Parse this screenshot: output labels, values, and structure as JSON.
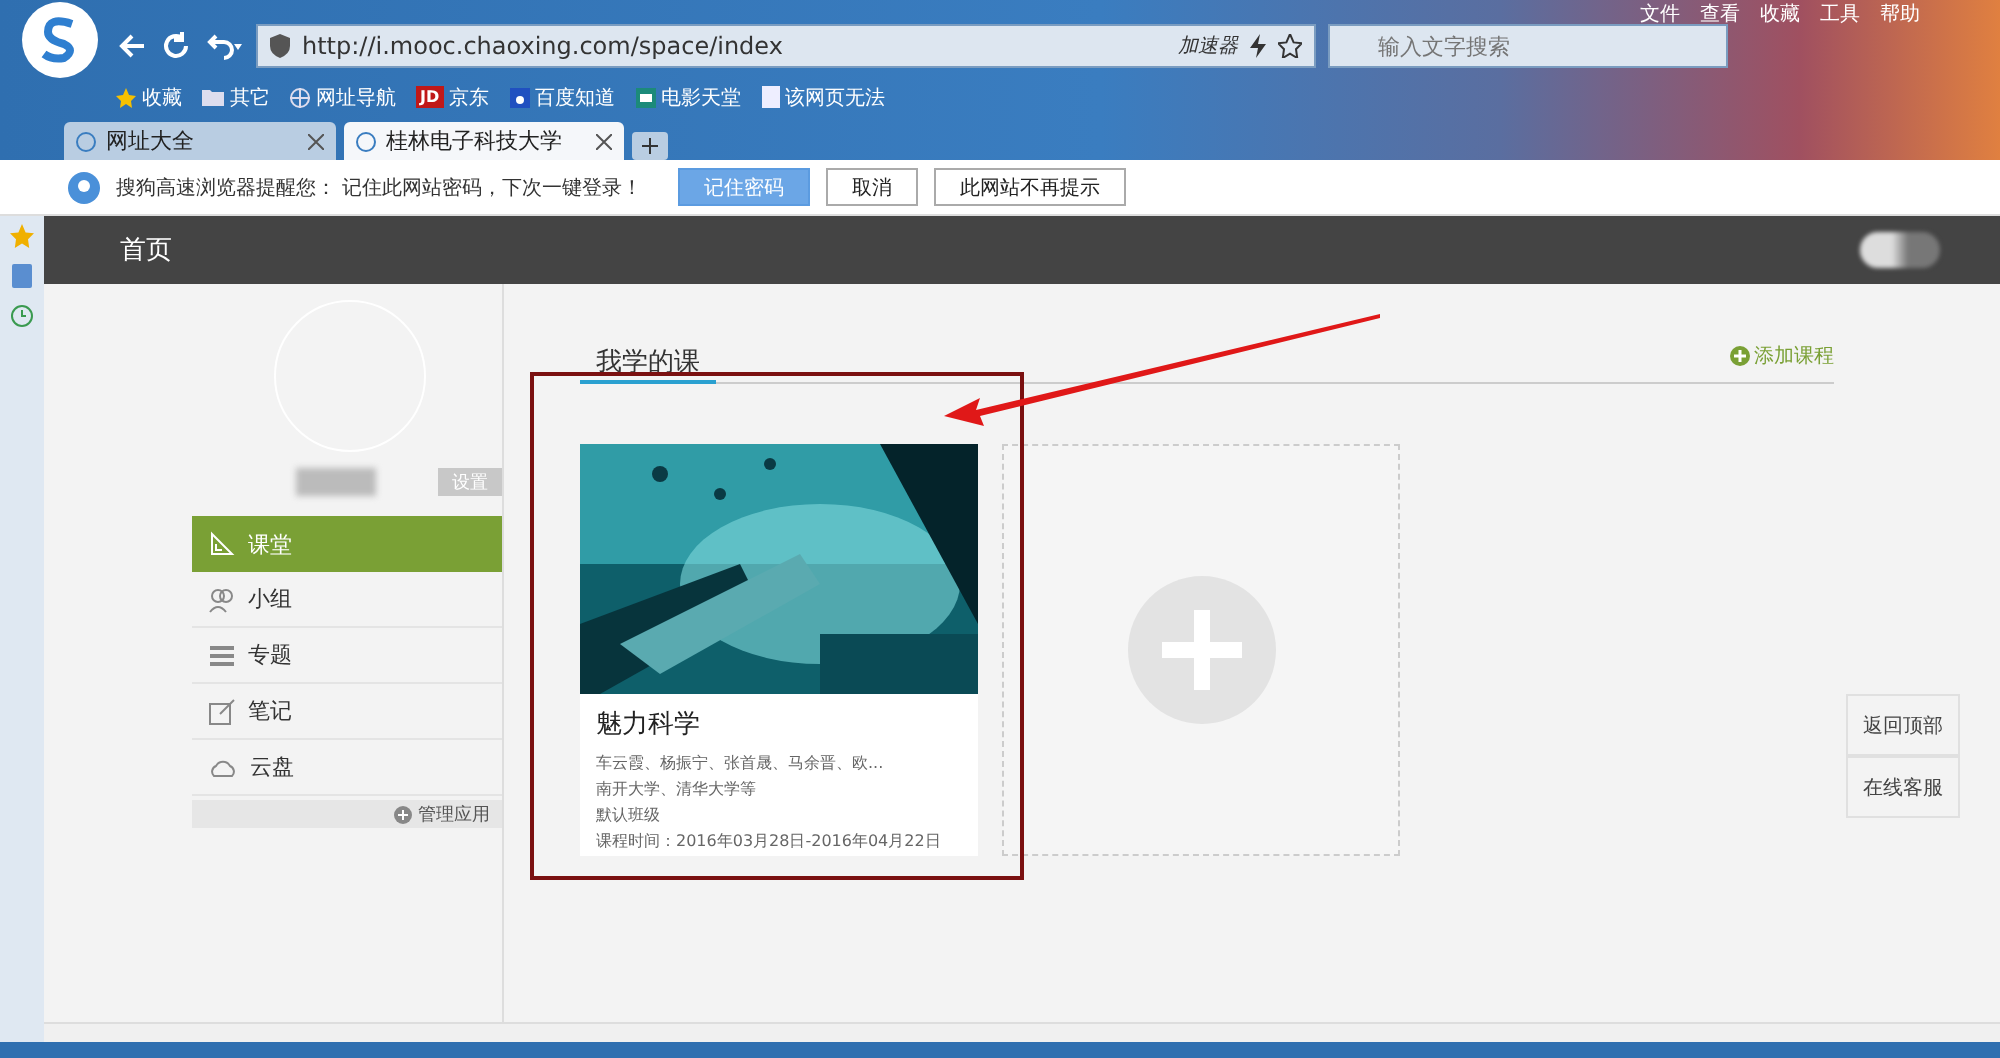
{
  "browser": {
    "address": "http://i.mooc.chaoxing.com/space/index",
    "accelerator": "加速器",
    "search": {
      "placeholder": "输入文字搜索"
    },
    "menu": [
      "文件",
      "查看",
      "收藏",
      "工具",
      "帮助"
    ],
    "bookmarks": [
      {
        "kind": "star",
        "label": "收藏"
      },
      {
        "kind": "folder",
        "label": "其它"
      },
      {
        "kind": "globe",
        "label": "网址导航"
      },
      {
        "kind": "badge",
        "badge": "JD",
        "label": "京东"
      },
      {
        "kind": "paw",
        "label": "百度知道"
      },
      {
        "kind": "film",
        "label": "电影天堂"
      },
      {
        "kind": "page",
        "label": "该网页无法"
      }
    ],
    "tabs": [
      {
        "label": "网址大全",
        "selected": false
      },
      {
        "label": "桂林电子科技大学",
        "selected": true
      }
    ],
    "infobar": {
      "message": "搜狗高速浏览器提醒您： 记住此网站密码，下次一键登录！",
      "buttons": [
        {
          "label": "记住密码",
          "kind": "primary"
        },
        {
          "label": "取消",
          "kind": "plain"
        },
        {
          "label": "此网站不再提示",
          "kind": "plain"
        }
      ]
    }
  },
  "page": {
    "header": {
      "title": "首页"
    },
    "profile": {
      "settings": "设置"
    },
    "nav": [
      {
        "kind": "classroom",
        "label": "课堂",
        "selected": true
      },
      {
        "kind": "group",
        "label": "小组",
        "selected": false
      },
      {
        "kind": "topic",
        "label": "专题",
        "selected": false
      },
      {
        "kind": "note",
        "label": "笔记",
        "selected": false
      },
      {
        "kind": "cloud",
        "label": "云盘",
        "selected": false
      }
    ],
    "manage": "管理应用",
    "section": {
      "title": "我学的课",
      "add": "添加课程"
    },
    "courses": [
      {
        "title": "魅力科学",
        "teachers": "车云霞、杨振宁、张首晟、马余晋、欧...",
        "schools": "南开大学、清华大学等",
        "class": "默认班级",
        "time": "课程时间：2016年03月28日-2016年04月22日"
      }
    ],
    "side_buttons": [
      "返回顶部",
      "在线客服"
    ]
  }
}
